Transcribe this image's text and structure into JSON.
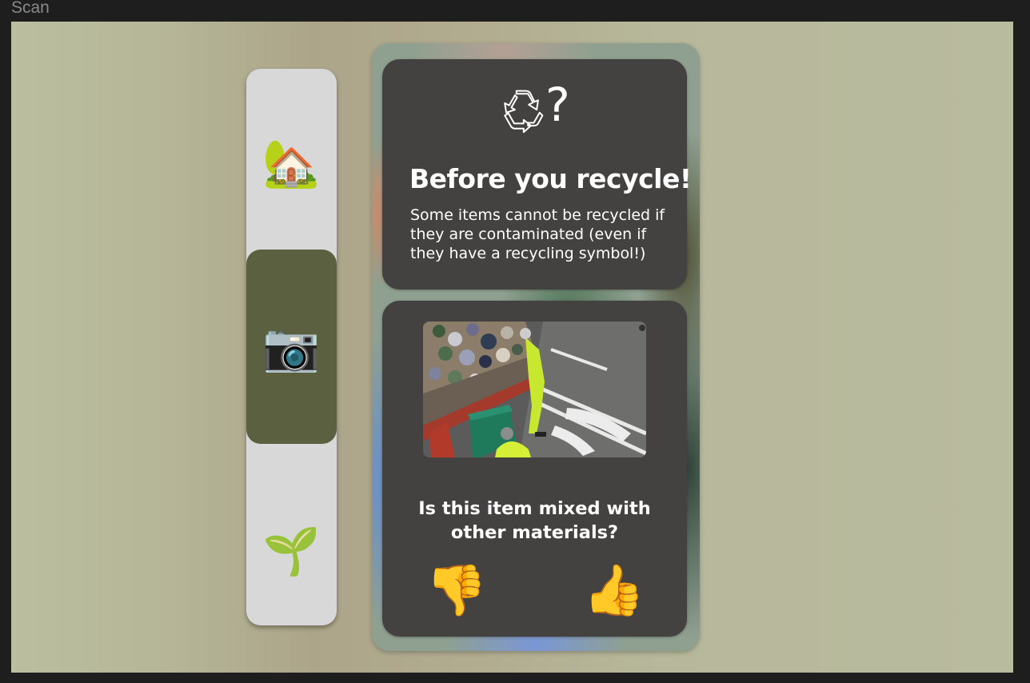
{
  "frame": {
    "label": "Scan"
  },
  "sidebar": {
    "items": [
      {
        "id": "home",
        "icon": "house-with-garden-icon",
        "glyph": "🏡",
        "active": false
      },
      {
        "id": "scan",
        "icon": "camera-icon",
        "glyph": "📷",
        "active": true
      },
      {
        "id": "grow",
        "icon": "seedling-icon",
        "glyph": "🌱",
        "active": false
      }
    ]
  },
  "info_card": {
    "icon": "recycle-icon",
    "question_glyph": "?",
    "title": "Before you recycle!",
    "text": "Some items cannot be recycled if they are contaminated (even if they have a recycling symbol!)"
  },
  "question_card": {
    "photo": "garbage-truck-photo",
    "question": "Is this item mixed with other materials?",
    "buttons": {
      "no": {
        "icon": "thumbs-down-icon",
        "glyph": "👎"
      },
      "yes": {
        "icon": "thumbs-up-icon",
        "glyph": "👍"
      }
    }
  },
  "colors": {
    "canvas": "#b7b89b",
    "sidebar": "#d8d8d8",
    "active_nav": "#5a6040",
    "card": "#434241"
  }
}
